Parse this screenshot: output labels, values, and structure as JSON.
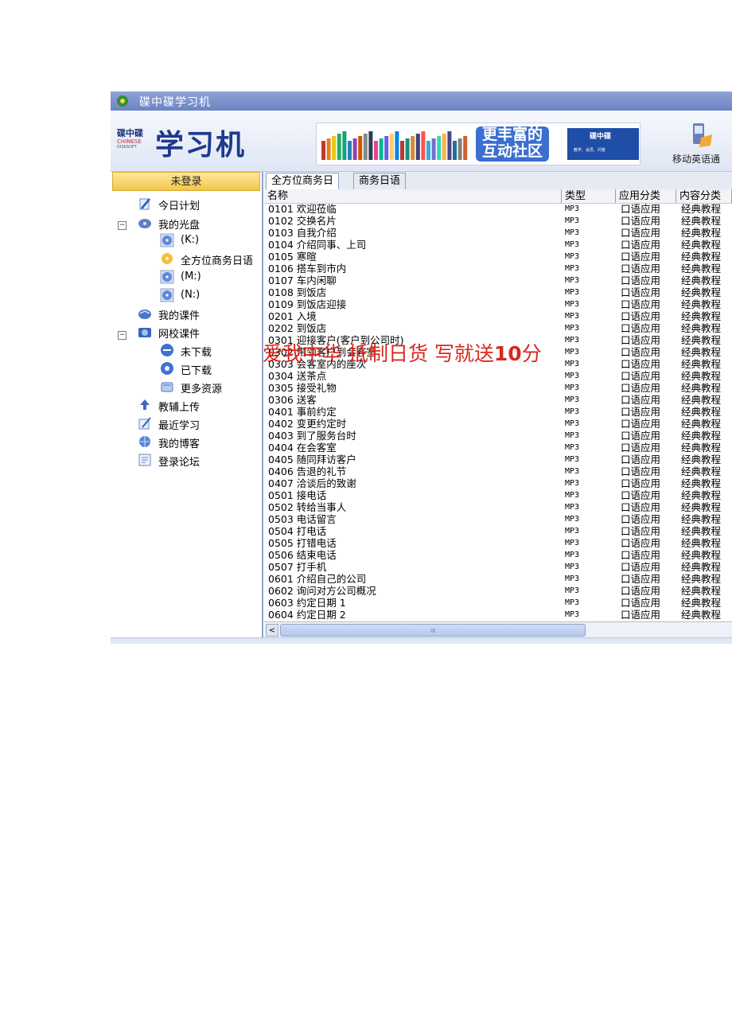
{
  "window": {
    "title": "碟中碟学习机"
  },
  "header": {
    "logo_brand": "碟中碟",
    "logo_sub": "CHINESE",
    "logo_tiny": "DISKSOFT",
    "logo_title": "学习机",
    "banner": {
      "slogan_line1": "更丰富的",
      "slogan_line2": "互动社区",
      "brand": "碟中碟",
      "tagline": "教学、会员、问答"
    },
    "mobile_label": "移动英语通"
  },
  "sidebar": {
    "login_label": "未登录",
    "items": [
      {
        "label": "今日计划",
        "icon": "pen-paper-icon"
      },
      {
        "label": "我的光盘",
        "icon": "disc-drive-icon"
      },
      {
        "label": "(K:)",
        "icon": "disc-icon"
      },
      {
        "label": "全方位商务日语",
        "icon": "disc-gold-icon"
      },
      {
        "label": "(M:)",
        "icon": "disc-icon"
      },
      {
        "label": "(N:)",
        "icon": "disc-icon"
      },
      {
        "label": "我的课件",
        "icon": "book-icon"
      },
      {
        "label": "网校课件",
        "icon": "globe-courseware-icon"
      },
      {
        "label": "未下载",
        "icon": "download-pending-icon"
      },
      {
        "label": "已下载",
        "icon": "download-done-icon"
      },
      {
        "label": "更多资源",
        "icon": "more-resources-icon"
      },
      {
        "label": "教辅上传",
        "icon": "upload-icon"
      },
      {
        "label": "最近学习",
        "icon": "recent-icon"
      },
      {
        "label": "我的博客",
        "icon": "blog-icon"
      },
      {
        "label": "登录论坛",
        "icon": "forum-icon"
      }
    ]
  },
  "tabs": [
    {
      "label": "全方位商务日",
      "active": true
    },
    {
      "label": "商务日语",
      "active": false
    }
  ],
  "columns": {
    "name": "名称",
    "type": "类型",
    "app": "应用分类",
    "cat": "内容分类"
  },
  "rows": [
    {
      "name": "0101 欢迎莅临",
      "type": "MP3",
      "app": "口语应用",
      "cat": "经典教程"
    },
    {
      "name": "0102 交换名片",
      "type": "MP3",
      "app": "口语应用",
      "cat": "经典教程"
    },
    {
      "name": "0103 自我介绍",
      "type": "MP3",
      "app": "口语应用",
      "cat": "经典教程"
    },
    {
      "name": "0104 介绍同事、上司",
      "type": "MP3",
      "app": "口语应用",
      "cat": "经典教程"
    },
    {
      "name": "0105 寒暄",
      "type": "MP3",
      "app": "口语应用",
      "cat": "经典教程"
    },
    {
      "name": "0106 搭车到市内",
      "type": "MP3",
      "app": "口语应用",
      "cat": "经典教程"
    },
    {
      "name": "0107 车内闲聊",
      "type": "MP3",
      "app": "口语应用",
      "cat": "经典教程"
    },
    {
      "name": "0108 到饭店",
      "type": "MP3",
      "app": "口语应用",
      "cat": "经典教程"
    },
    {
      "name": "0109 到饭店迎接",
      "type": "MP3",
      "app": "口语应用",
      "cat": "经典教程"
    },
    {
      "name": "0201 入境",
      "type": "MP3",
      "app": "口语应用",
      "cat": "经典教程"
    },
    {
      "name": "0202 到饭店",
      "type": "MP3",
      "app": "口语应用",
      "cat": "经典教程"
    },
    {
      "name": "0301 迎接客户(客户到公司时)",
      "type": "MP3",
      "app": "口语应用",
      "cat": "经典教程"
    },
    {
      "name": "0302 带领客户到会客室",
      "type": "MP3",
      "app": "口语应用",
      "cat": "经典教程"
    },
    {
      "name": "0303 会客室内的座次",
      "type": "MP3",
      "app": "口语应用",
      "cat": "经典教程"
    },
    {
      "name": "0304 送茶点",
      "type": "MP3",
      "app": "口语应用",
      "cat": "经典教程"
    },
    {
      "name": "0305 接受礼物",
      "type": "MP3",
      "app": "口语应用",
      "cat": "经典教程"
    },
    {
      "name": "0306 送客",
      "type": "MP3",
      "app": "口语应用",
      "cat": "经典教程"
    },
    {
      "name": "0401 事前约定",
      "type": "MP3",
      "app": "口语应用",
      "cat": "经典教程"
    },
    {
      "name": "0402 变更约定时",
      "type": "MP3",
      "app": "口语应用",
      "cat": "经典教程"
    },
    {
      "name": "0403 到了服务台时",
      "type": "MP3",
      "app": "口语应用",
      "cat": "经典教程"
    },
    {
      "name": "0404 在会客室",
      "type": "MP3",
      "app": "口语应用",
      "cat": "经典教程"
    },
    {
      "name": "0405 随同拜访客户",
      "type": "MP3",
      "app": "口语应用",
      "cat": "经典教程"
    },
    {
      "name": "0406 告退的礼节",
      "type": "MP3",
      "app": "口语应用",
      "cat": "经典教程"
    },
    {
      "name": "0407 洽谈后的致谢",
      "type": "MP3",
      "app": "口语应用",
      "cat": "经典教程"
    },
    {
      "name": "0501 接电话",
      "type": "MP3",
      "app": "口语应用",
      "cat": "经典教程"
    },
    {
      "name": "0502 转给当事人",
      "type": "MP3",
      "app": "口语应用",
      "cat": "经典教程"
    },
    {
      "name": "0503 电话留言",
      "type": "MP3",
      "app": "口语应用",
      "cat": "经典教程"
    },
    {
      "name": "0504 打电话",
      "type": "MP3",
      "app": "口语应用",
      "cat": "经典教程"
    },
    {
      "name": "0505 打错电话",
      "type": "MP3",
      "app": "口语应用",
      "cat": "经典教程"
    },
    {
      "name": "0506 结束电话",
      "type": "MP3",
      "app": "口语应用",
      "cat": "经典教程"
    },
    {
      "name": "0507 打手机",
      "type": "MP3",
      "app": "口语应用",
      "cat": "经典教程"
    },
    {
      "name": "0601 介绍自己的公司",
      "type": "MP3",
      "app": "口语应用",
      "cat": "经典教程"
    },
    {
      "name": "0602 询问对方公司概况",
      "type": "MP3",
      "app": "口语应用",
      "cat": "经典教程"
    },
    {
      "name": "0603 约定日期 1",
      "type": "MP3",
      "app": "口语应用",
      "cat": "经典教程"
    },
    {
      "name": "0604 约定日期 2",
      "type": "MP3",
      "app": "口语应用",
      "cat": "经典教程"
    }
  ],
  "watermark": {
    "text": "爱我中华 抵制日货 写就送",
    "number": "10",
    "suffix": "分"
  },
  "scroll": {
    "left_arrow": "<",
    "right_arrow": ">",
    "grip": "III"
  }
}
